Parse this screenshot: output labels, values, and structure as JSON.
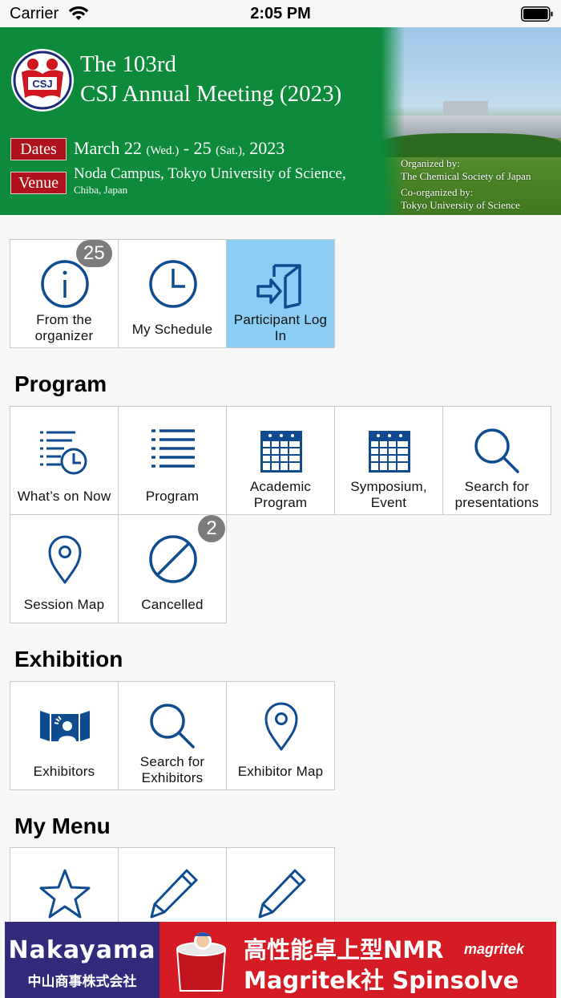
{
  "status_bar": {
    "carrier": "Carrier",
    "time": "2:05 PM"
  },
  "banner": {
    "logo_text": "CSJ",
    "title_line1": "The 103rd",
    "title_line2": "CSJ Annual Meeting (2023)",
    "dates_tag": "Dates",
    "dates_a": "March 22",
    "dates_a_day": "(Wed.)",
    "dates_sep": "-",
    "dates_b": "25",
    "dates_b_day": "(Sat.),",
    "dates_year": "2023",
    "venue_tag": "Venue",
    "venue_line1": "Noda Campus, Tokyo University of Science,",
    "venue_line2": "Chiba, Japan",
    "organized_label": "Organized by:",
    "organized_by": "The Chemical Society of Japan",
    "coorganized_label": "Co-organized by:",
    "coorganized_by": "Tokyo University of Science"
  },
  "top_menu": [
    {
      "label": "From the organizer",
      "icon": "info-icon",
      "badge": "25"
    },
    {
      "label": "My Schedule",
      "icon": "clock-icon"
    },
    {
      "label": "Participant Log In",
      "icon": "login-icon"
    }
  ],
  "program": {
    "title": "Program",
    "items": [
      {
        "label": "What’s on Now",
        "icon": "list-clock-icon"
      },
      {
        "label": "Program",
        "icon": "list-icon"
      },
      {
        "label": "Academic Program",
        "icon": "calendar-icon"
      },
      {
        "label": "Symposium, Event",
        "icon": "calendar-icon"
      },
      {
        "label": "Search for presentations",
        "icon": "search-icon"
      },
      {
        "label": "Session Map",
        "icon": "map-pin-icon"
      },
      {
        "label": "Cancelled",
        "icon": "cancel-icon",
        "badge": "2"
      }
    ]
  },
  "exhibition": {
    "title": "Exhibition",
    "items": [
      {
        "label": "Exhibitors",
        "icon": "exhibitor-icon"
      },
      {
        "label": "Search for Exhibitors",
        "icon": "search-icon"
      },
      {
        "label": "Exhibitor Map",
        "icon": "map-pin-icon"
      }
    ]
  },
  "my_menu": {
    "title": "My Menu",
    "items": [
      {
        "icon": "star-icon"
      },
      {
        "icon": "pencil-icon"
      },
      {
        "icon": "pencil-icon"
      }
    ]
  },
  "ad": {
    "company": "Nakayama",
    "company_jp": "中山商事株式会社",
    "line1": "高性能卓上型NMR",
    "line2": "Magritek社 Spinsolve",
    "brand": "magritek"
  },
  "colors": {
    "icon_blue": "#0f4c8f",
    "banner_green": "#0d8a3a",
    "tag_red": "#b0121b",
    "active_tile": "#8ccdf5",
    "badge_gray": "#7c7c7c",
    "ad_navy": "#322b7c",
    "ad_red": "#d51c25"
  }
}
